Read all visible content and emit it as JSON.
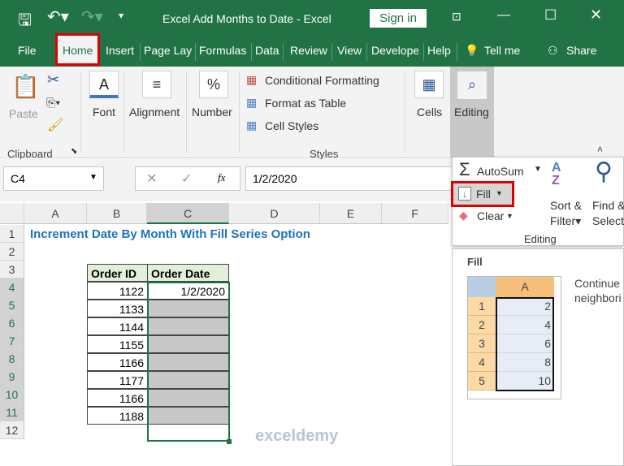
{
  "title": {
    "doc": "Excel Add Months to Date  -  Excel",
    "sign_in": "Sign in"
  },
  "tabs": [
    "File",
    "Home",
    "Insert",
    "Page Lay",
    "Formulas",
    "Data",
    "Review",
    "View",
    "Develope",
    "Help",
    "Tell me",
    "Share"
  ],
  "ribbon": {
    "paste": "Paste",
    "clipboard": "Clipboard",
    "font": "Font",
    "alignment": "Alignment",
    "number": "Number",
    "conditional": "Conditional Formatting",
    "format_table": "Format as Table",
    "cell_styles": "Cell Styles",
    "styles": "Styles",
    "cells": "Cells",
    "editing": "Editing"
  },
  "formula_bar": {
    "name_box": "C4",
    "fx": "fx",
    "value": "1/2/2020"
  },
  "columns": [
    "A",
    "B",
    "C",
    "D",
    "E",
    "F"
  ],
  "rows": [
    "1",
    "2",
    "3",
    "4",
    "5",
    "6",
    "7",
    "8",
    "9",
    "10",
    "11",
    "12"
  ],
  "sheet": {
    "heading": "Increment Date By Month With Fill Series Option",
    "headers": [
      "Order ID",
      "Order Date"
    ],
    "order_ids": [
      "1122",
      "1133",
      "1144",
      "1155",
      "1166",
      "1177",
      "1166",
      "1188"
    ],
    "first_date": "1/2/2020"
  },
  "editing_panel": {
    "autosum": "AutoSum",
    "fill": "Fill",
    "clear": "Clear",
    "sort1": "Sort &",
    "sort2": "Filter",
    "find1": "Find &",
    "find2": "Select",
    "group": "Editing"
  },
  "tooltip": {
    "title": "Fill",
    "col": "A",
    "rows": [
      "1",
      "2",
      "3",
      "4",
      "5"
    ],
    "values": [
      "2",
      "4",
      "6",
      "8",
      "10"
    ],
    "desc1": "Continue",
    "desc2": "neighbori"
  },
  "watermark": "exceldemy",
  "colors": {
    "excel_green": "#217346",
    "highlight": "#e00000",
    "heading_blue": "#1e73be",
    "header_fill": "#e2efda",
    "selection_fill": "#c8c8c8"
  }
}
